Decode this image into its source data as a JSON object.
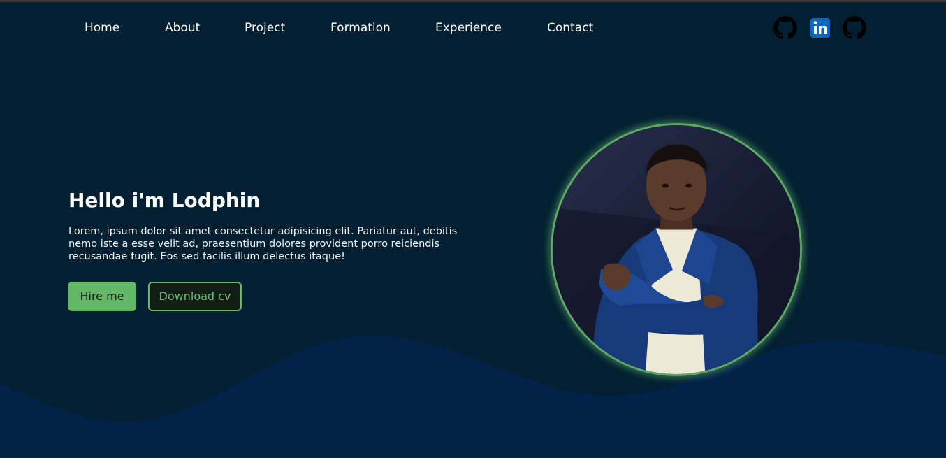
{
  "nav": {
    "links": [
      "Home",
      "About",
      "Project",
      "Formation",
      "Experience",
      "Contact"
    ],
    "social": [
      {
        "icon": "github-icon"
      },
      {
        "icon": "linkedin-icon"
      },
      {
        "icon": "github-icon"
      }
    ]
  },
  "hero": {
    "title": "Hello i'm Lodphin",
    "text": "Lorem, ipsum dolor sit amet consectetur adipisicing elit. Pariatur aut, debitis nemo iste a esse velit ad, praesentium dolores provident porro reiciendis recusandae fugit. Eos sed facilis illum delectus itaque!",
    "hire_label": "Hire me",
    "cv_label": "Download cv"
  },
  "colors": {
    "background": "#022031",
    "wave": "#02224a",
    "accent": "#63b767",
    "linkedin": "#0a66c2"
  }
}
